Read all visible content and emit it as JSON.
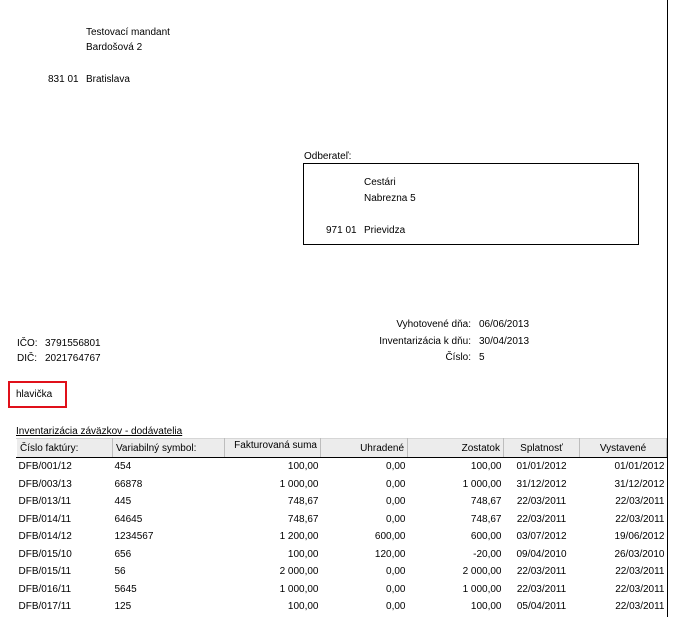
{
  "sender": {
    "name": "Testovací mandant",
    "street": "Bardošová 2",
    "zip": "831 01",
    "city": "Bratislava"
  },
  "recipient": {
    "label": "Odberateľ:",
    "name": "Cestári",
    "street": "Nabrezna 5",
    "zip": "971 01",
    "city": "Prievidza"
  },
  "ids": {
    "ico_label": "IČO:",
    "ico_value": "3791556801",
    "dic_label": "DIČ:",
    "dic_value": "2021764767"
  },
  "meta": {
    "issued_label": "Vyhotovené dňa:",
    "issued_value": "06/06/2013",
    "inventory_label": "Inventarizácia k dňu:",
    "inventory_value": "30/04/2013",
    "number_label": "Číslo:",
    "number_value": "5"
  },
  "header_tag": "hlavička",
  "section_title": "Inventarizácia záväzkov - dodávatelia",
  "columns": [
    "Číslo faktúry:",
    "Variabilný symbol:",
    "Fakturovaná suma",
    "Uhradené",
    "Zostatok",
    "Splatnosť",
    "Vystavené"
  ],
  "rows": [
    [
      "DFB/001/12",
      "454",
      "100,00",
      "0,00",
      "100,00",
      "01/01/2012",
      "01/01/2012"
    ],
    [
      "DFB/003/13",
      "66878",
      "1 000,00",
      "0,00",
      "1 000,00",
      "31/12/2012",
      "31/12/2012"
    ],
    [
      "DFB/013/11",
      "445",
      "748,67",
      "0,00",
      "748,67",
      "22/03/2011",
      "22/03/2011"
    ],
    [
      "DFB/014/11",
      "64645",
      "748,67",
      "0,00",
      "748,67",
      "22/03/2011",
      "22/03/2011"
    ],
    [
      "DFB/014/12",
      "1234567",
      "1 200,00",
      "600,00",
      "600,00",
      "03/07/2012",
      "19/06/2012"
    ],
    [
      "DFB/015/10",
      "656",
      "100,00",
      "120,00",
      "-20,00",
      "09/04/2010",
      "26/03/2010"
    ],
    [
      "DFB/015/11",
      "56",
      "2 000,00",
      "0,00",
      "2 000,00",
      "22/03/2011",
      "22/03/2011"
    ],
    [
      "DFB/016/11",
      "5645",
      "1 000,00",
      "0,00",
      "1 000,00",
      "22/03/2011",
      "22/03/2011"
    ],
    [
      "DFB/017/11",
      "125",
      "100,00",
      "0,00",
      "100,00",
      "05/04/2011",
      "22/03/2011"
    ]
  ]
}
